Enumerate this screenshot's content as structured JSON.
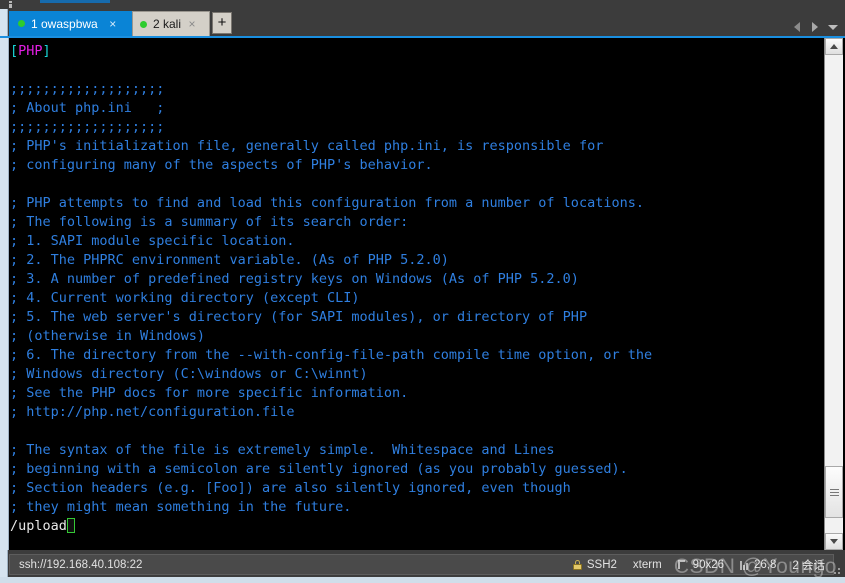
{
  "window": {
    "grip_icon": "drag-grip-icon"
  },
  "tabbar": {
    "tabs": [
      {
        "index": "1",
        "name": "owaspbwa",
        "label": "1 owaspbwa",
        "active": true,
        "status": "connected",
        "close_label": "×"
      },
      {
        "index": "2",
        "name": "kali",
        "label": "2 kali",
        "active": false,
        "status": "connected",
        "close_label": "×"
      }
    ],
    "new_tab_label": "+",
    "nav": {
      "prev_icon": "arrow-left-icon",
      "next_icon": "arrow-right-icon",
      "list_icon": "chevron-down-icon"
    }
  },
  "terminal": {
    "lines": [
      {
        "type": "section",
        "prefix": "[",
        "name": "PHP",
        "suffix": "]"
      },
      {
        "type": "blank",
        "text": ""
      },
      {
        "type": "comment",
        "text": ";;;;;;;;;;;;;;;;;;;"
      },
      {
        "type": "comment",
        "text": "; About php.ini   ;"
      },
      {
        "type": "comment",
        "text": ";;;;;;;;;;;;;;;;;;;"
      },
      {
        "type": "comment",
        "text": "; PHP's initialization file, generally called php.ini, is responsible for"
      },
      {
        "type": "comment",
        "text": "; configuring many of the aspects of PHP's behavior."
      },
      {
        "type": "blank",
        "text": ""
      },
      {
        "type": "comment",
        "text": "; PHP attempts to find and load this configuration from a number of locations."
      },
      {
        "type": "comment",
        "text": "; The following is a summary of its search order:"
      },
      {
        "type": "comment",
        "text": "; 1. SAPI module specific location."
      },
      {
        "type": "comment",
        "text": "; 2. The PHPRC environment variable. (As of PHP 5.2.0)"
      },
      {
        "type": "comment",
        "text": "; 3. A number of predefined registry keys on Windows (As of PHP 5.2.0)"
      },
      {
        "type": "comment",
        "text": "; 4. Current working directory (except CLI)"
      },
      {
        "type": "comment",
        "text": "; 5. The web server's directory (for SAPI modules), or directory of PHP"
      },
      {
        "type": "comment",
        "text": "; (otherwise in Windows)"
      },
      {
        "type": "comment",
        "text": "; 6. The directory from the --with-config-file-path compile time option, or the"
      },
      {
        "type": "comment",
        "text": "; Windows directory (C:\\windows or C:\\winnt)"
      },
      {
        "type": "comment",
        "text": "; See the PHP docs for more specific information."
      },
      {
        "type": "comment",
        "text": "; http://php.net/configuration.file"
      },
      {
        "type": "blank",
        "text": ""
      },
      {
        "type": "comment",
        "text": "; The syntax of the file is extremely simple.  Whitespace and Lines"
      },
      {
        "type": "comment",
        "text": "; beginning with a semicolon are silently ignored (as you probably guessed)."
      },
      {
        "type": "comment",
        "text": "; Section headers (e.g. [Foo]) are also silently ignored, even though"
      },
      {
        "type": "comment",
        "text": "; they might mean something in the future."
      },
      {
        "type": "prompt",
        "text": "/upload"
      }
    ],
    "colors": {
      "background": "#000000",
      "comment": "#2f7fe0",
      "section_bracket": "#19d7d7",
      "section_name": "#e31ee3",
      "prompt_text": "#e8e8e8",
      "cursor": "#35c935"
    }
  },
  "scrollbar": {
    "up_icon": "scroll-up-arrow-icon",
    "down_icon": "scroll-down-arrow-icon",
    "thumb_icon": "scroll-thumb-grip-icon"
  },
  "statusbar": {
    "url": "ssh://192.168.40.108:22",
    "protocol": "SSH2",
    "protocol_icon": "lock-icon",
    "emulation": "xterm",
    "size_icon": "terminal-size-icon",
    "size": "90x26",
    "cursor_icon": "cursor-position-icon",
    "cursor_position": "26,8",
    "sessions": "2 会话",
    "resize_icon": "resize-grip-icon"
  },
  "watermark": {
    "text": "CSDN @Youngo"
  }
}
